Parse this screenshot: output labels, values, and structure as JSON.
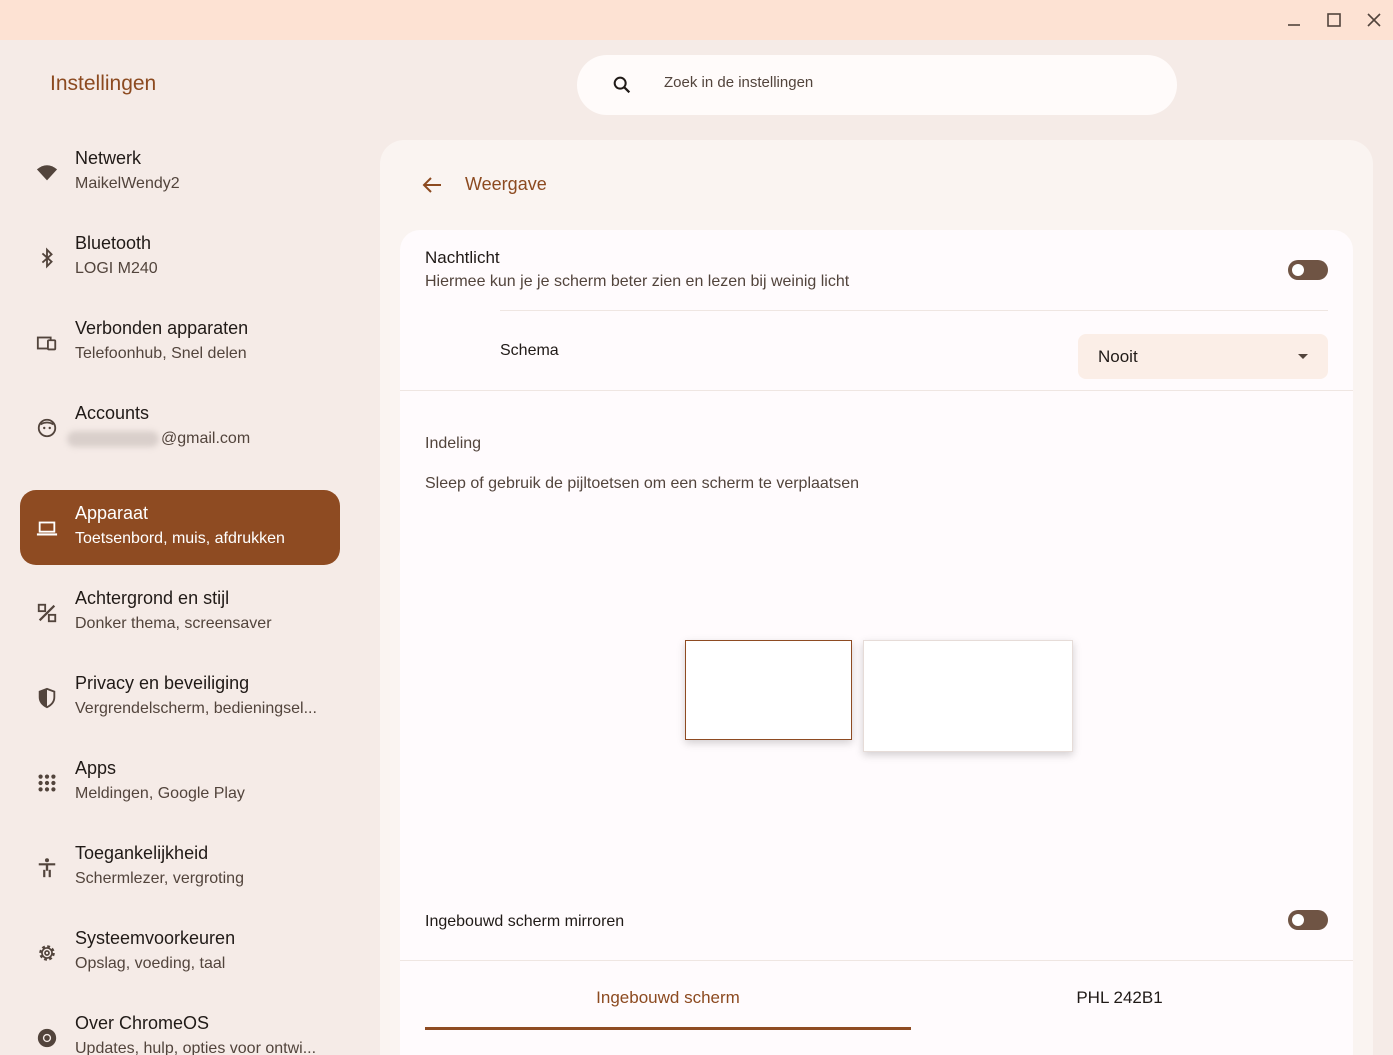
{
  "window": {
    "controls": [
      "minimize-icon",
      "maximize-icon",
      "close-icon"
    ]
  },
  "app": {
    "title": "Instellingen"
  },
  "search": {
    "placeholder": "Zoek in de instellingen"
  },
  "sidebar": {
    "items": [
      {
        "icon": "wifi-icon",
        "title": "Netwerk",
        "subtitle": "MaikelWendy2",
        "active": false
      },
      {
        "icon": "bluetooth-icon",
        "title": "Bluetooth",
        "subtitle": "LOGI M240",
        "active": false
      },
      {
        "icon": "connected-devices-icon",
        "title": "Verbonden apparaten",
        "subtitle": "Telefoonhub, Snel delen",
        "active": false
      },
      {
        "icon": "account-face-icon",
        "title": "Accounts",
        "subtitle": "@gmail.com",
        "active": false
      },
      {
        "icon": "laptop-icon",
        "title": "Apparaat",
        "subtitle": "Toetsenbord, muis, afdrukken",
        "active": true
      },
      {
        "icon": "palette-brush-icon",
        "title": "Achtergrond en stijl",
        "subtitle": "Donker thema, screensaver",
        "active": false
      },
      {
        "icon": "shield-icon",
        "title": "Privacy en beveiliging",
        "subtitle": "Vergrendelscherm, bedieningsel...",
        "active": false
      },
      {
        "icon": "apps-grid-icon",
        "title": "Apps",
        "subtitle": "Meldingen, Google Play",
        "active": false
      },
      {
        "icon": "accessibility-icon",
        "title": "Toegankelijkheid",
        "subtitle": "Schermlezer, vergroting",
        "active": false
      },
      {
        "icon": "gear-icon",
        "title": "Systeemvoorkeuren",
        "subtitle": "Opslag, voeding, taal",
        "active": false
      },
      {
        "icon": "chrome-icon",
        "title": "Over ChromeOS",
        "subtitle": "Updates, hulp, opties voor ontwi...",
        "active": false
      }
    ]
  },
  "main": {
    "title": "Weergave",
    "nightlight": {
      "title": "Nachtlicht",
      "description": "Hiermee kun je je scherm beter zien en lezen bij weinig licht",
      "enabled": false
    },
    "schedule": {
      "label": "Schema",
      "value": "Nooit"
    },
    "arrangement": {
      "heading": "Indeling",
      "instructions": "Sleep of gebruik de pijltoetsen om een scherm te verplaatsen"
    },
    "mirror": {
      "label": "Ingebouwd scherm mirroren",
      "enabled": false
    },
    "tabs": [
      {
        "label": "Ingebouwd scherm",
        "selected": true
      },
      {
        "label": "PHL 242B1",
        "selected": false
      }
    ]
  },
  "colors": {
    "accent": "#8e4b22",
    "titlebar": "#fde2d3",
    "background": "#f5ebe7",
    "toggle_off": "#6f5444"
  }
}
